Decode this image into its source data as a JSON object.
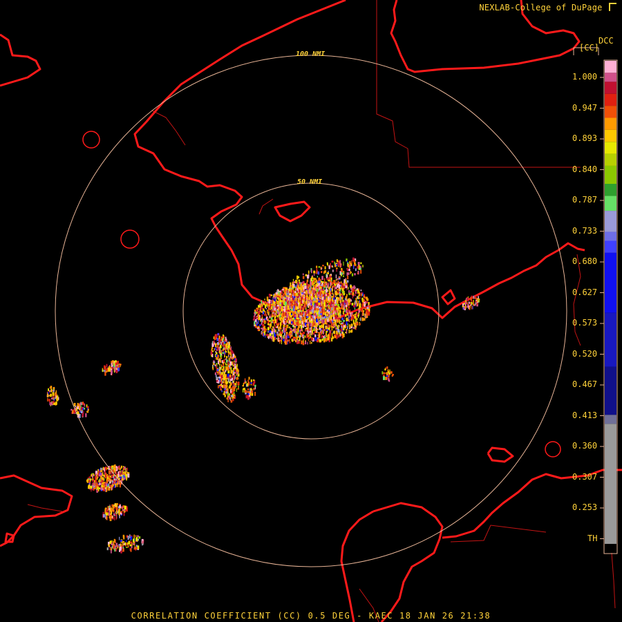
{
  "header": {
    "credit": "NEXLAB-College of DuPage",
    "logo_icon": "cod-logo-icon"
  },
  "footer": {
    "caption": "CORRELATION COEFFICIENT (CC) 0.5 DEG - KAEC 18 JAN 26 21:38"
  },
  "radar": {
    "rings": [
      {
        "label": "100 NMI",
        "range_nmi": 100
      },
      {
        "label": "50 NMI",
        "range_nmi": 50
      }
    ],
    "colors": {
      "ring": "#e8b496",
      "coast": "#ff1a1a",
      "border": "#c41414",
      "text": "#ffd23a"
    }
  },
  "legend": {
    "product": "DCC",
    "unit": "[CC]",
    "ticks": [
      "1.000",
      "0.947",
      "0.893",
      "0.840",
      "0.787",
      "0.733",
      "0.680",
      "0.627",
      "0.573",
      "0.520",
      "0.467",
      "0.413",
      "0.360",
      "0.307",
      "0.253",
      "TH"
    ],
    "color_bands": [
      {
        "color": "#ffb0d4",
        "from": 1.02,
        "to": 1.0
      },
      {
        "color": "#d0508a",
        "from": 1.0,
        "to": 0.985
      },
      {
        "color": "#c01030",
        "from": 0.985,
        "to": 0.965
      },
      {
        "color": "#e02010",
        "from": 0.965,
        "to": 0.945
      },
      {
        "color": "#f05008",
        "from": 0.945,
        "to": 0.925
      },
      {
        "color": "#ff9a00",
        "from": 0.925,
        "to": 0.905
      },
      {
        "color": "#ffc800",
        "from": 0.905,
        "to": 0.885
      },
      {
        "color": "#e8e800",
        "from": 0.885,
        "to": 0.865
      },
      {
        "color": "#b8d000",
        "from": 0.865,
        "to": 0.845
      },
      {
        "color": "#8cc800",
        "from": 0.845,
        "to": 0.815
      },
      {
        "color": "#2ea02e",
        "from": 0.815,
        "to": 0.795
      },
      {
        "color": "#66e066",
        "from": 0.795,
        "to": 0.77
      },
      {
        "color": "#9a9ad8",
        "from": 0.77,
        "to": 0.735
      },
      {
        "color": "#6e6ee8",
        "from": 0.735,
        "to": 0.72
      },
      {
        "color": "#4040ff",
        "from": 0.72,
        "to": 0.7
      },
      {
        "color": "#1010f0",
        "from": 0.7,
        "to": 0.6
      },
      {
        "color": "#1818c0",
        "from": 0.6,
        "to": 0.51
      },
      {
        "color": "#10108a",
        "from": 0.51,
        "to": 0.43
      },
      {
        "color": "#707098",
        "from": 0.43,
        "to": 0.415
      },
      {
        "color": "#9a9a9a",
        "from": 0.415,
        "to": 0.215
      },
      {
        "color": "#000000",
        "from": 0.215,
        "to": 0.2
      }
    ]
  }
}
